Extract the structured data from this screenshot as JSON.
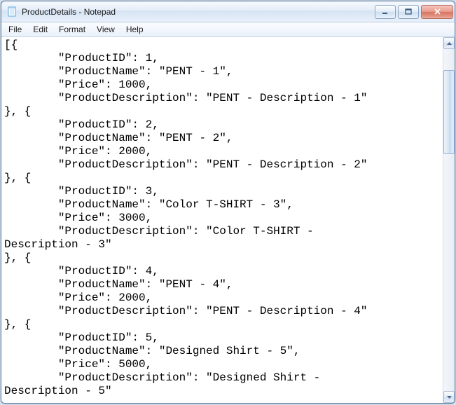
{
  "window": {
    "title": "ProductDetails - Notepad"
  },
  "menu": {
    "file": "File",
    "edit": "Edit",
    "format": "Format",
    "view": "View",
    "help": "Help"
  },
  "content": "[{\n        \"ProductID\": 1,\n        \"ProductName\": \"PENT - 1\",\n        \"Price\": 1000,\n        \"ProductDescription\": \"PENT - Description - 1\"\n}, {\n        \"ProductID\": 2,\n        \"ProductName\": \"PENT - 2\",\n        \"Price\": 2000,\n        \"ProductDescription\": \"PENT - Description - 2\"\n}, {\n        \"ProductID\": 3,\n        \"ProductName\": \"Color T-SHIRT - 3\",\n        \"Price\": 3000,\n        \"ProductDescription\": \"Color T-SHIRT - \nDescription - 3\"\n}, {\n        \"ProductID\": 4,\n        \"ProductName\": \"PENT - 4\",\n        \"Price\": 2000,\n        \"ProductDescription\": \"PENT - Description - 4\"\n}, {\n        \"ProductID\": 5,\n        \"ProductName\": \"Designed Shirt - 5\",\n        \"Price\": 5000,\n        \"ProductDescription\": \"Designed Shirt - \nDescription - 5\""
}
